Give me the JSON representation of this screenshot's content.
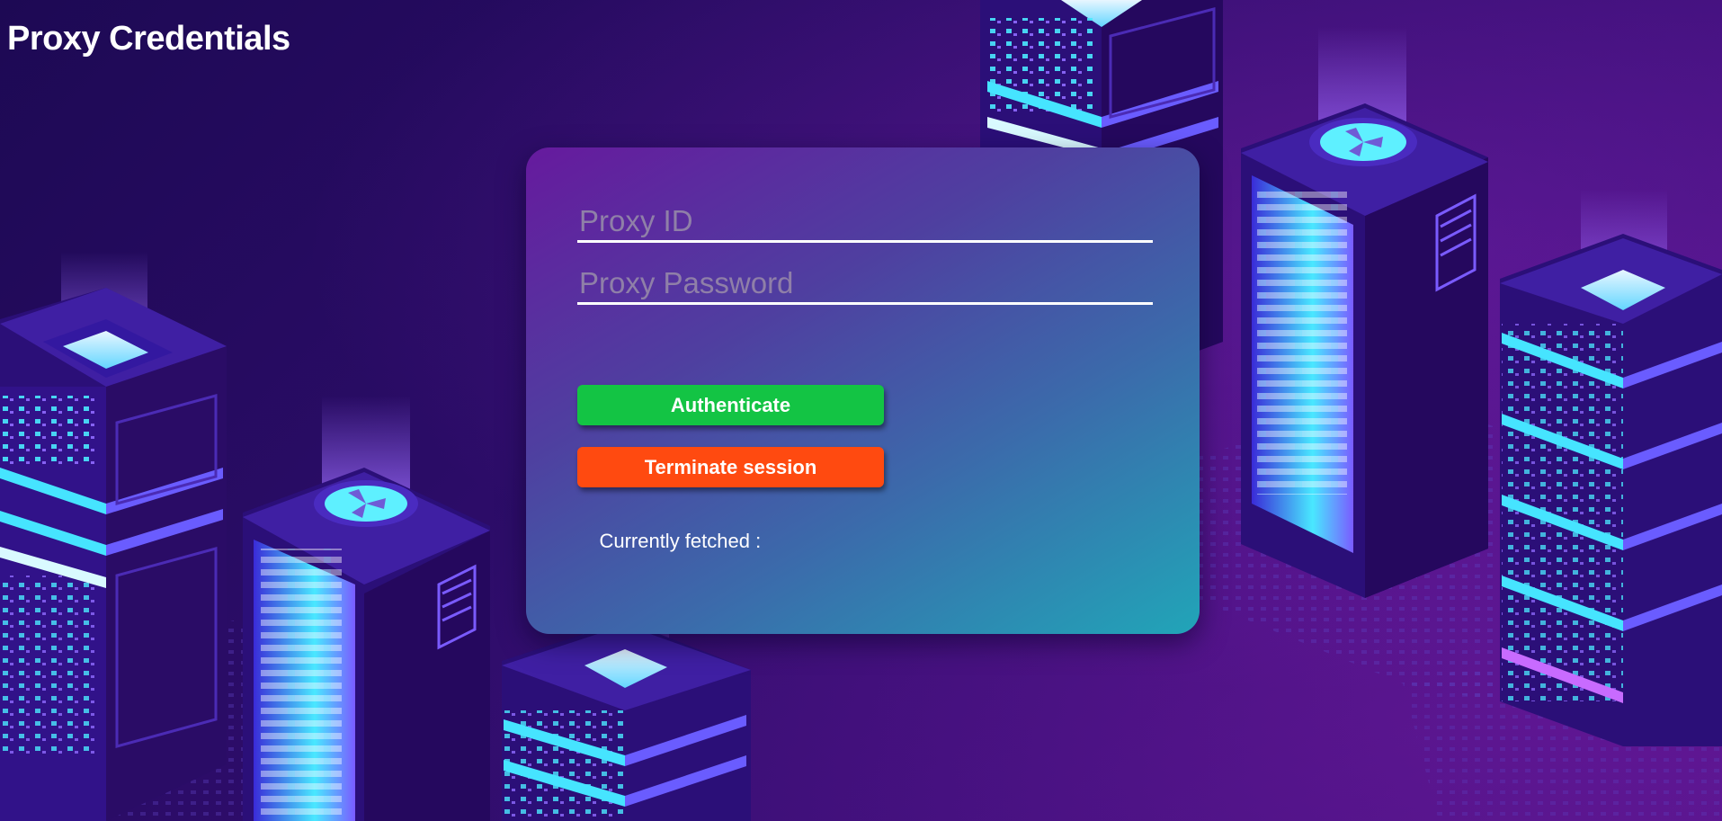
{
  "page": {
    "title": "Proxy Credentials"
  },
  "form": {
    "proxy_id": {
      "value": "",
      "placeholder": "Proxy ID"
    },
    "proxy_password": {
      "value": "",
      "placeholder": "Proxy Password"
    },
    "authenticate_label": "Authenticate",
    "terminate_label": "Terminate session",
    "currently_fetched_label": "Currently fetched :",
    "currently_fetched_value": ""
  },
  "colors": {
    "authenticate": "#13c444",
    "terminate": "#ff4a10",
    "card_start": "#661a9e",
    "card_end": "#21a5b8",
    "background": "#2a0c66",
    "server_glow": "#5ef0ff"
  },
  "icons": {
    "background_art": "isometric-server-racks-illustration",
    "fan": "fan-icon"
  }
}
